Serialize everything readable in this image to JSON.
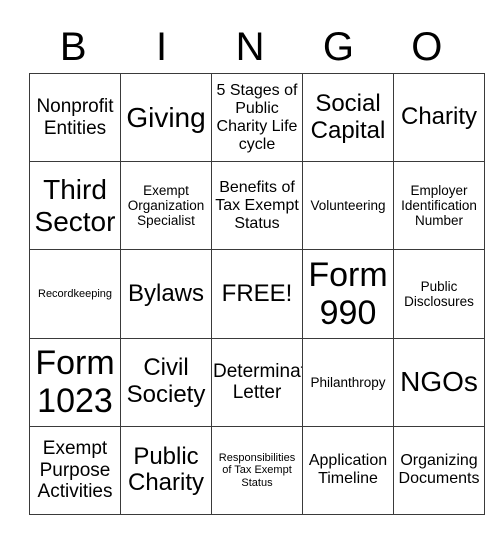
{
  "header": {
    "letters": [
      "B",
      "I",
      "N",
      "G",
      "O"
    ]
  },
  "board": {
    "rows": [
      [
        "Nonprofit Entities",
        "Giving",
        "5 Stages of Public Charity Life cycle",
        "Social Capital",
        "Charity"
      ],
      [
        "Third Sector",
        "Exempt Organization Specialist",
        "Benefits of Tax Exempt Status",
        "Volunteering",
        "Employer Identification Number"
      ],
      [
        "Recordkeeping",
        "Bylaws",
        "FREE!",
        "Form 990",
        "Public Disclosures"
      ],
      [
        "Form 1023",
        "Civil Society",
        "Determination Letter",
        "Philanthropy",
        "NGOs"
      ],
      [
        "Exempt Purpose Activities",
        "Public Charity",
        "Responsibilities of Tax Exempt Status",
        "Application Timeline",
        "Organizing Documents"
      ]
    ],
    "free_space": "FREE!"
  }
}
